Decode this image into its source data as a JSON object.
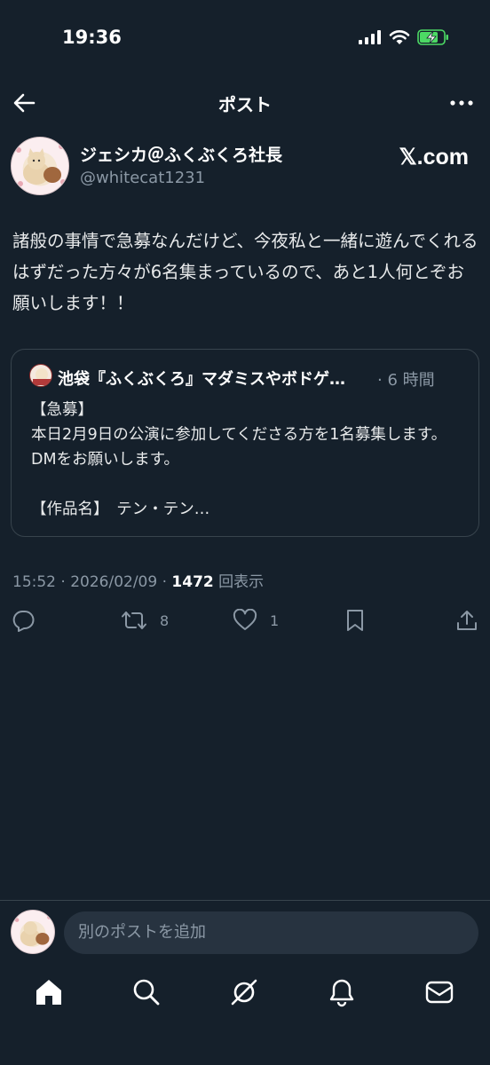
{
  "status_bar": {
    "time": "19:36"
  },
  "nav": {
    "title": "ポスト"
  },
  "post": {
    "author_name": "ジェシカ＠ふくぶくろ社長",
    "author_handle": "@whitecat1231",
    "brand": "𝕏.com",
    "text": "諸般の事情で急募なんだけど、今夜私と一緒に遊んでくれるはずだった方々が6名集まっているので、あと1人何とぞお願いします！！",
    "quote": {
      "author_name": "池袋『ふくぶくろ』マダミスやボドゲ…",
      "time": "· 6 時間",
      "text": "【急募】\n本日2月9日の公演に参加してくださる方を1名募集します。DMをお願いします。\n\n【作品名】　テン・テン…"
    },
    "timestamp": "15:52 · 2026/02/09 · ",
    "views_count": "1472",
    "views_label": " 回表示",
    "reposts": "8",
    "likes": "1"
  },
  "composer": {
    "placeholder": "別のポストを追加"
  },
  "colors": {
    "background": "#15202b",
    "muted": "#8b98a5",
    "border": "#38444d",
    "battery": "#4cd964"
  }
}
